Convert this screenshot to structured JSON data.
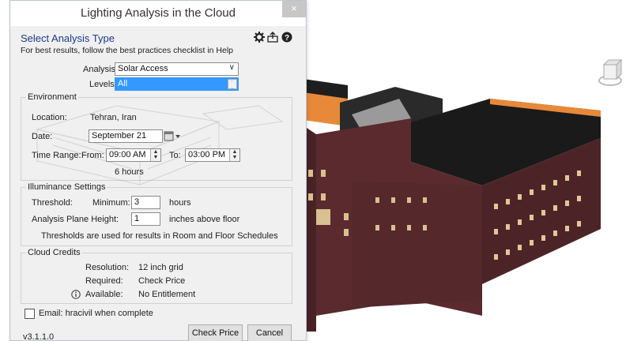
{
  "window": {
    "title": "Lighting Analysis in the Cloud",
    "close_label": "×"
  },
  "header": {
    "heading": "Select Analysis Type",
    "hint": "For best results, follow the best practices checklist in Help",
    "icons": [
      "gear-icon",
      "export-icon",
      "help-icon"
    ]
  },
  "analysis": {
    "label": "Analysis:",
    "value": "Solar Access"
  },
  "levels": {
    "label": "Levels:",
    "value": "All"
  },
  "environment": {
    "title": "Environment",
    "location_label": "Location:",
    "location_value": "Tehran, Iran",
    "date_label": "Date:",
    "date_value": "September 21",
    "time_range_label": "Time Range:",
    "from_label": "From:",
    "from_value": "09:00 AM",
    "to_label": "To:",
    "to_value": "03:00 PM",
    "duration": "6 hours"
  },
  "illuminance": {
    "title": "Illuminance Settings",
    "threshold_label": "Threshold:",
    "minimum_label": "Minimum:",
    "minimum_value": "3",
    "minimum_unit": "hours",
    "plane_height_label": "Analysis Plane Height:",
    "plane_height_value": "1",
    "plane_height_unit": "inches above floor",
    "note": "Thresholds are used for results in Room and Floor Schedules"
  },
  "credits": {
    "title": "Cloud Credits",
    "resolution_label": "Resolution:",
    "resolution_value": "12 inch grid",
    "required_label": "Required:",
    "required_value": "Check Price",
    "available_label": "Available:",
    "available_value": "No Entitlement"
  },
  "email": {
    "label": "Email: hracivil when complete",
    "checked": false
  },
  "footer": {
    "version": "v3.1.1.0",
    "check_price_label": "Check Price",
    "cancel_label": "Cancel"
  },
  "colors": {
    "heading": "#1a3a8a",
    "selection": "#3399ff",
    "roof": "#1e1e1e",
    "brick": "#5a2a2e",
    "parapet": "#e8893a"
  }
}
